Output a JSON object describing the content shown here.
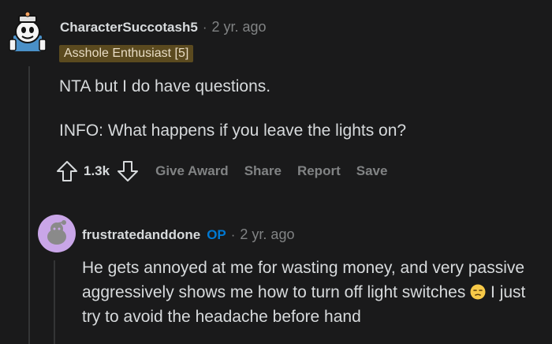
{
  "comment": {
    "author": "CharacterSuccotash5",
    "separator": "·",
    "time": "2 yr. ago",
    "flair": "Asshole Enthusiast [5]",
    "paragraphs": [
      "NTA but I do have questions.",
      "INFO: What happens if you leave the lights on?"
    ],
    "score": "1.3k",
    "actions": {
      "give_award": "Give Award",
      "share": "Share",
      "report": "Report",
      "save": "Save"
    }
  },
  "reply": {
    "author": "frustratedanddone",
    "op_badge": "OP",
    "separator": "·",
    "time": "2 yr. ago",
    "text_before_emoji": "He gets annoyed at me for wasting money, and very passive aggressively shows me how to turn off light switches",
    "text_after_emoji": "I just try to avoid the headache before hand"
  },
  "icons": {
    "upvote": "upvote-arrow-icon",
    "downvote": "downvote-arrow-icon",
    "emoji": "unamused-face-emoji"
  },
  "colors": {
    "background": "#1a1a1b",
    "text": "#d7dadc",
    "muted": "#818384",
    "op_blue": "#0079d3",
    "flair_bg": "#5b4a1f",
    "avatar2_bg": "#c9a6e8"
  }
}
